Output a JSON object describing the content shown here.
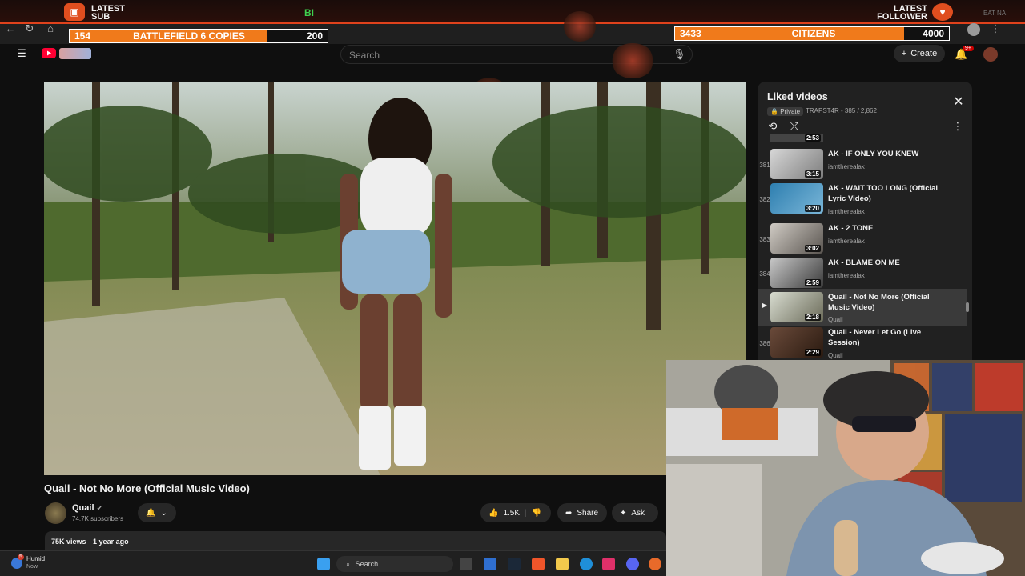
{
  "overlay": {
    "latest_sub_label": "LATEST SUB",
    "latest_follower_label": "LATEST FOLLOWER",
    "center_mark": "BI",
    "right_mark": "EAT NA",
    "goal_left": {
      "current": "154",
      "label": "BATTLEFIELD 6 COPIES",
      "target": "200"
    },
    "goal_right": {
      "current": "3433",
      "label": "CITIZENS",
      "target": "4000"
    },
    "accent_color": "#f07a1b"
  },
  "youtube": {
    "search_placeholder": "Search",
    "create_label": "Create",
    "notification_badge": "9+",
    "video": {
      "title": "Quail - Not No More (Official Music Video)",
      "channel": "Quail",
      "subscribers": "74.7K subscribers",
      "likes": "1.5K",
      "share_label": "Share",
      "ask_label": "Ask",
      "views": "75K views",
      "age": "1 year ago"
    },
    "playlist": {
      "title": "Liked videos",
      "privacy": "Private",
      "meta": "TRAPST4R - 385 / 2,862",
      "items": [
        {
          "num": "381",
          "title": "AK - IF ONLY YOU KNEW",
          "channel": "iamtherealak",
          "duration": "3:15"
        },
        {
          "num": "382",
          "title": "AK - WAIT TOO LONG (Official Lyric Video)",
          "channel": "iamtherealak",
          "duration": "3:20"
        },
        {
          "num": "383",
          "title": "AK - 2 TONE",
          "channel": "iamtherealak",
          "duration": "3:02"
        },
        {
          "num": "384",
          "title": "AK - BLAME ON ME",
          "channel": "iamtherealak",
          "duration": "2:59"
        },
        {
          "num": "▶",
          "title": "Quail - Not No More (Official Music Video)",
          "channel": "Quail",
          "duration": "2:18"
        },
        {
          "num": "386",
          "title": "Quail - Never Let Go (Live Session)",
          "channel": "Quail",
          "duration": "2:29"
        }
      ],
      "partial_duration": "2:53"
    }
  },
  "taskbar": {
    "weather_badge": "5",
    "weather_label": "Humid",
    "weather_time": "Now",
    "search_placeholder": "Search"
  }
}
